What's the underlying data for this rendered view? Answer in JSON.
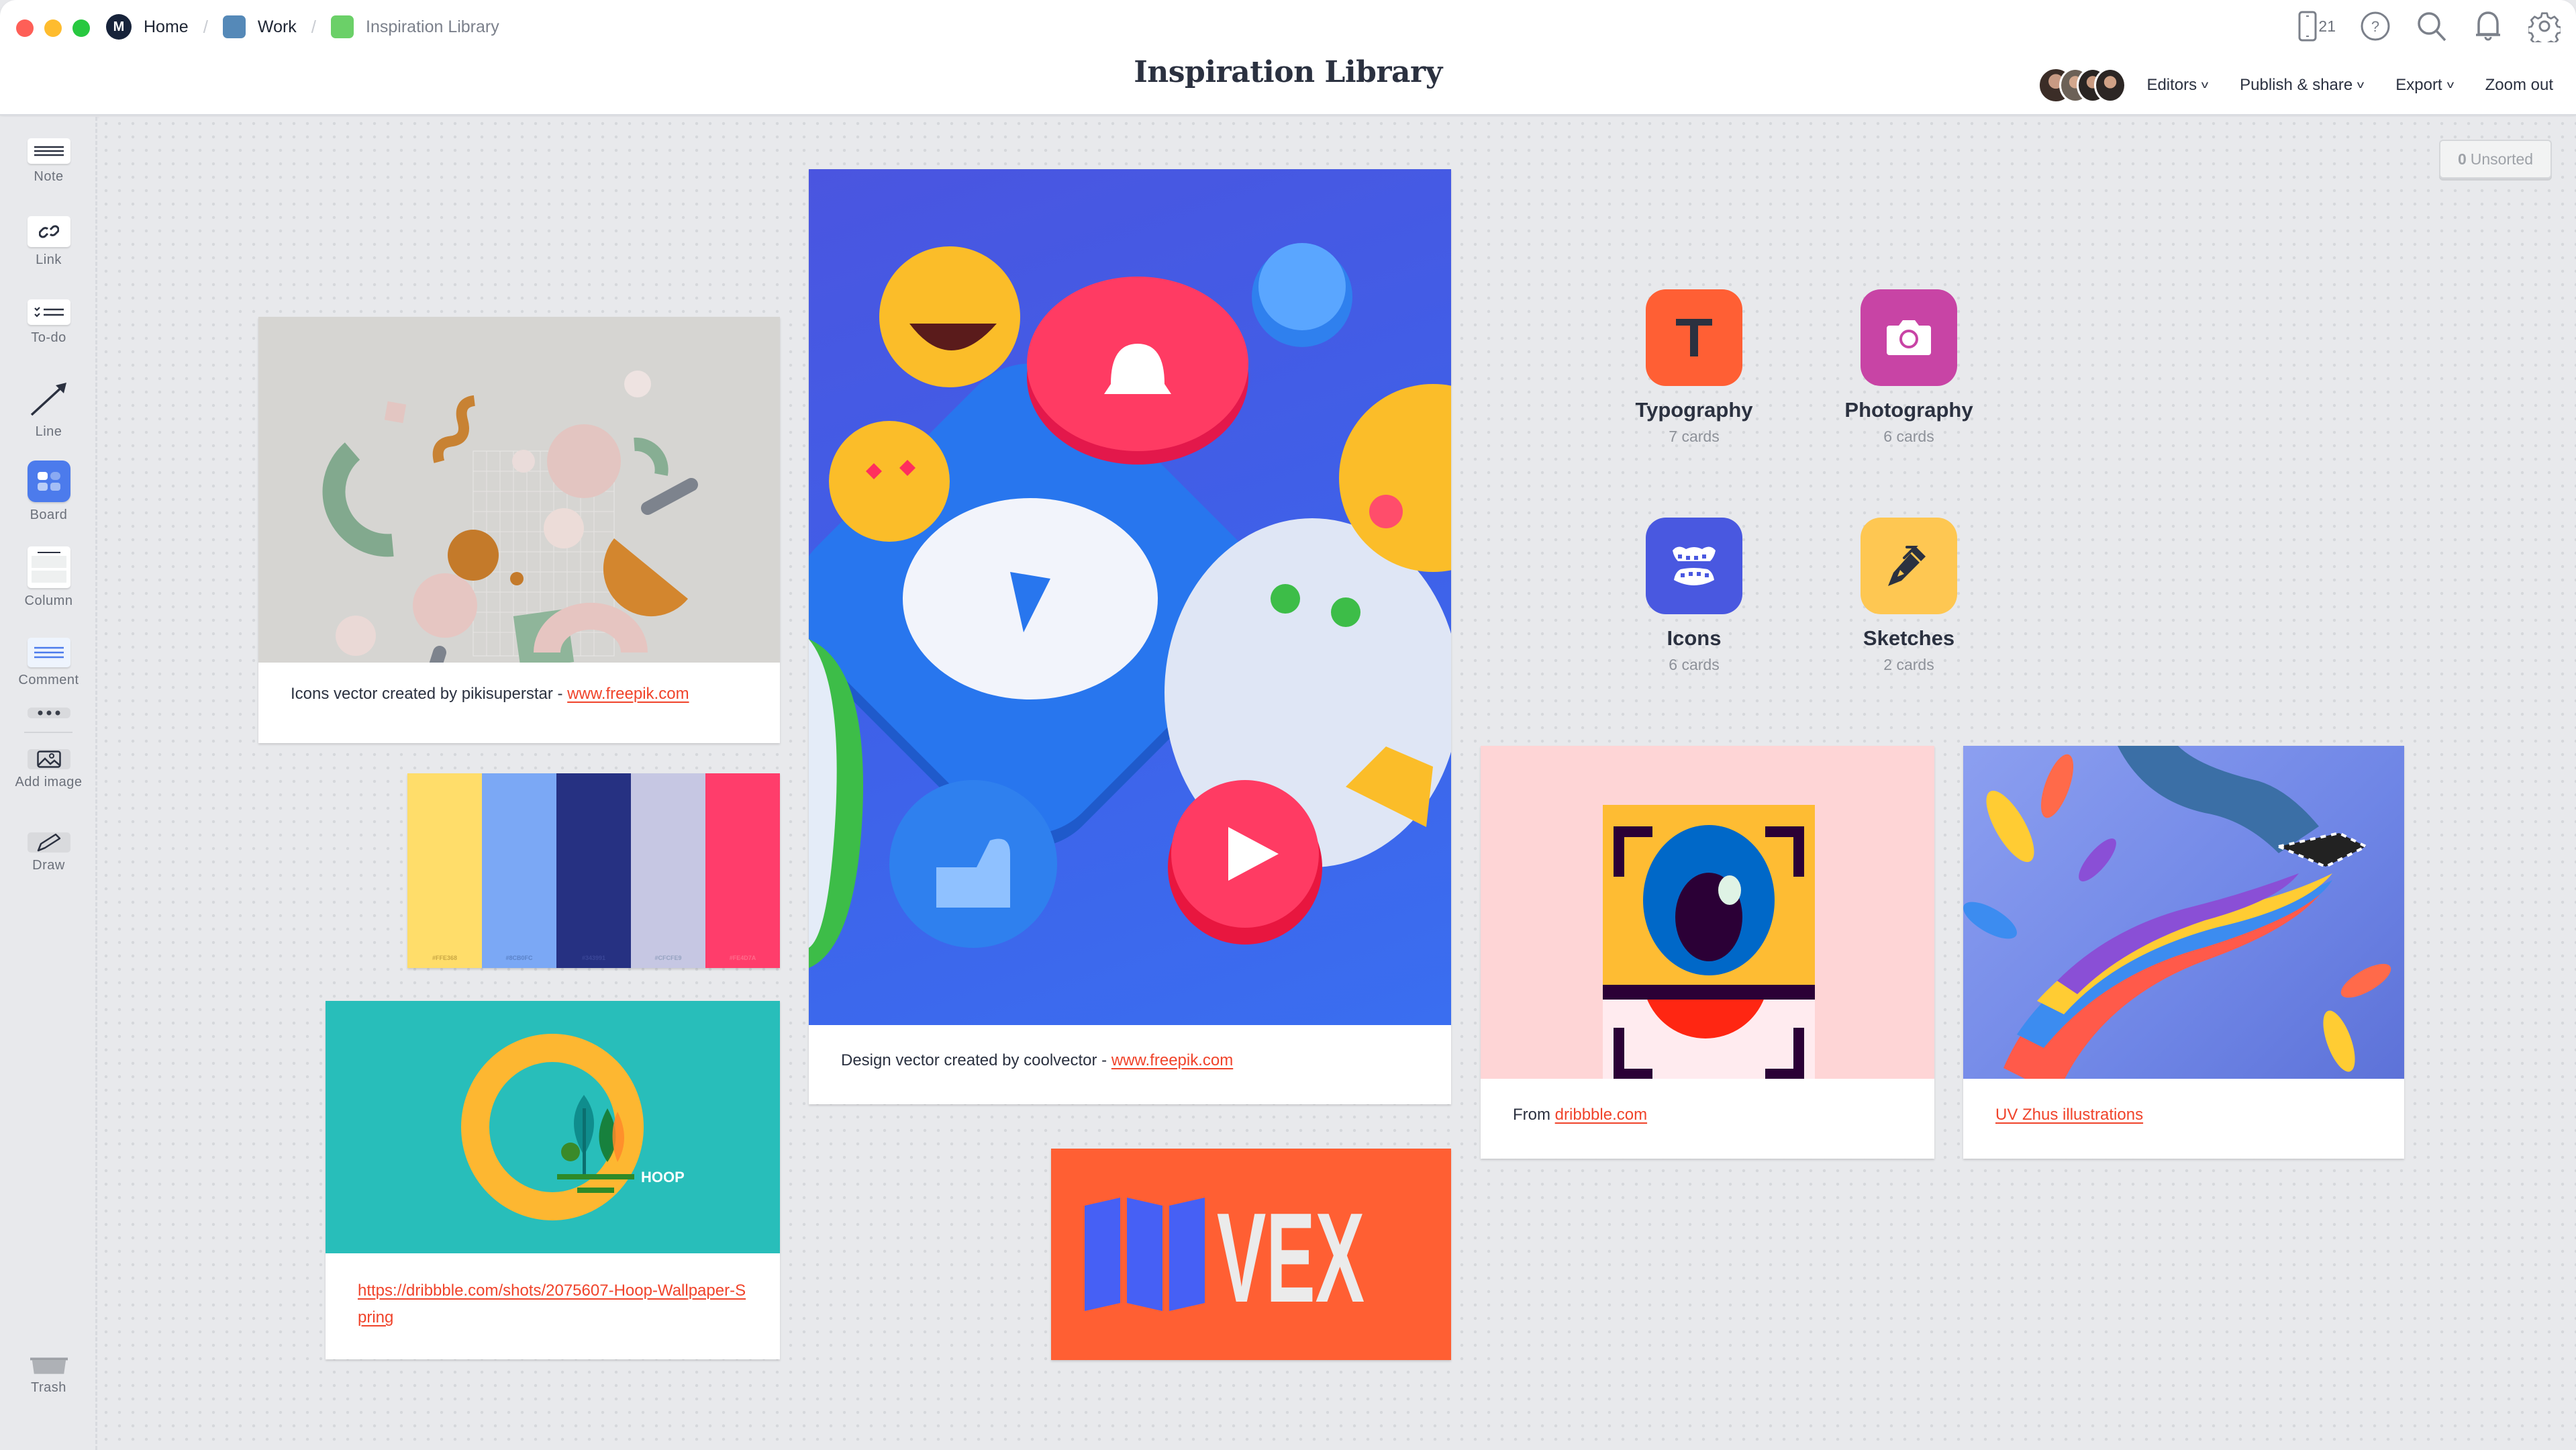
{
  "window": {
    "traffic_lights": {
      "close": "#fe5f57",
      "minimize": "#febc2e",
      "maximize": "#28c840"
    }
  },
  "breadcrumb": [
    {
      "label": "Home",
      "icon": "milanote-logo-icon",
      "color": "#17233a"
    },
    {
      "label": "Work",
      "icon": "board-square-icon",
      "color": "#5589b8"
    },
    {
      "label": "Inspiration Library",
      "icon": "board-square-icon",
      "color": "#6bd068"
    }
  ],
  "header": {
    "title": "Inspiration Library",
    "device_count": "21",
    "icons": [
      "mobile-device-icon",
      "help-icon",
      "search-icon",
      "notification-bell-icon",
      "settings-gear-icon"
    ],
    "actions": {
      "editors": "Editors",
      "publish": "Publish & share",
      "export": "Export",
      "zoom_out": "Zoom out"
    },
    "editor_avatar_count": 4
  },
  "sidebar": {
    "tools": [
      {
        "label": "Note",
        "icon": "note-icon"
      },
      {
        "label": "Link",
        "icon": "link-icon"
      },
      {
        "label": "To-do",
        "icon": "todo-icon"
      },
      {
        "label": "Line",
        "icon": "line-arrow-icon"
      },
      {
        "label": "Board",
        "icon": "board-icon"
      },
      {
        "label": "Column",
        "icon": "column-icon"
      },
      {
        "label": "Comment",
        "icon": "comment-icon"
      },
      {
        "label": "",
        "icon": "more-icon"
      },
      {
        "label": "Add image",
        "icon": "image-icon"
      },
      {
        "label": "Draw",
        "icon": "pencil-icon"
      },
      {
        "label": "Trash",
        "icon": "trash-icon"
      }
    ]
  },
  "canvas": {
    "unsorted": {
      "count": "0",
      "label": "Unsorted"
    },
    "cards": {
      "shapes": {
        "caption": "Icons vector created by pikisuperstar - ",
        "link": "www.freepik.com"
      },
      "emoji": {
        "caption": "Design vector created by coolvector - ",
        "link": "www.freepik.com"
      },
      "hoop": {
        "link": "https://dribbble.com/shots/2075607-Hoop-Wallpaper-Spring",
        "logo_text": "HOOP"
      },
      "eye": {
        "caption": "From ",
        "link": "dribbble.com"
      },
      "uv": {
        "link": "UV Zhus illustrations"
      },
      "vex": {
        "logo_text": "VEX"
      }
    },
    "palette": {
      "swatches": [
        {
          "hex": "#FFE368",
          "color": "#ffdd6a"
        },
        {
          "hex": "#8CB0FC",
          "color": "#7ba8f5"
        },
        {
          "hex": "#343991",
          "color": "#263182"
        },
        {
          "hex": "#CFCFE9",
          "color": "#c6c7e3"
        },
        {
          "hex": "#FE4D7A",
          "color": "#ff3d6b"
        }
      ]
    },
    "boards": [
      {
        "title": "Typography",
        "count": "7 cards",
        "color": "#ff5f34",
        "icon": "typography-t-icon"
      },
      {
        "title": "Photography",
        "count": "6 cards",
        "color": "#c844a5",
        "icon": "camera-icon"
      },
      {
        "title": "Icons",
        "count": "6 cards",
        "color": "#4958e0",
        "icon": "teeth-icon"
      },
      {
        "title": "Sketches",
        "count": "2 cards",
        "color": "#fec752",
        "icon": "pen-icon"
      }
    ]
  }
}
